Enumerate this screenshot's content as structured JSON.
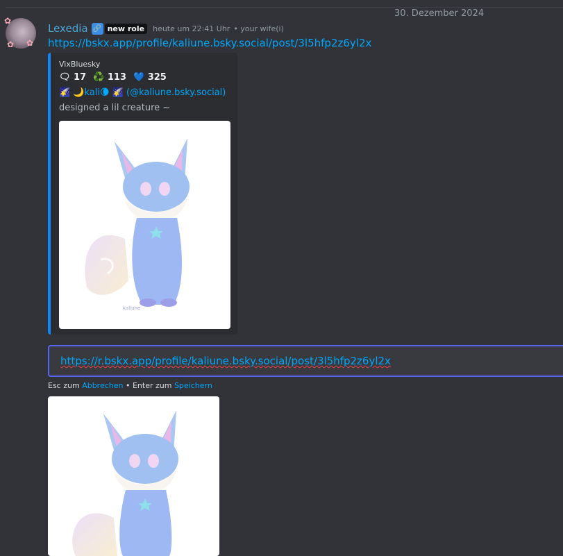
{
  "date_divider": "30. Dezember 2024",
  "message": {
    "username": "Lexedia",
    "role_icon": "link-icon",
    "role_badge": "new role",
    "timestamp": "heute um 22:41 Uhr",
    "relation": "• your wife(i)",
    "link": "https://bskx.app/profile/kaliune.bsky.social/post/3l5hfp2z6yl2x"
  },
  "embed": {
    "provider": "VixBluesky",
    "stats": {
      "comments": "🗨 17",
      "reposts": "♻️ 113",
      "likes": "💙 325"
    },
    "author": "🌠 🌙kali🌘 🌠 (@kaliune.bsky.social)",
    "description": "designed a lil creature ~",
    "image_signature": "kaliune",
    "accent_color": "#1185fe"
  },
  "edit": {
    "value": "https://r.bskx.app/profile/kaliune.bsky.social/post/3l5hfp2z6yl2x",
    "hint_esc": "Esc zum ",
    "hint_cancel": "Abbrechen",
    "hint_sep": " • Enter zum ",
    "hint_save": "Speichern"
  },
  "colors": {
    "background": "#313338",
    "link": "#00a8fc",
    "username": "#4aa8d8",
    "focus_border": "#5865f2"
  }
}
